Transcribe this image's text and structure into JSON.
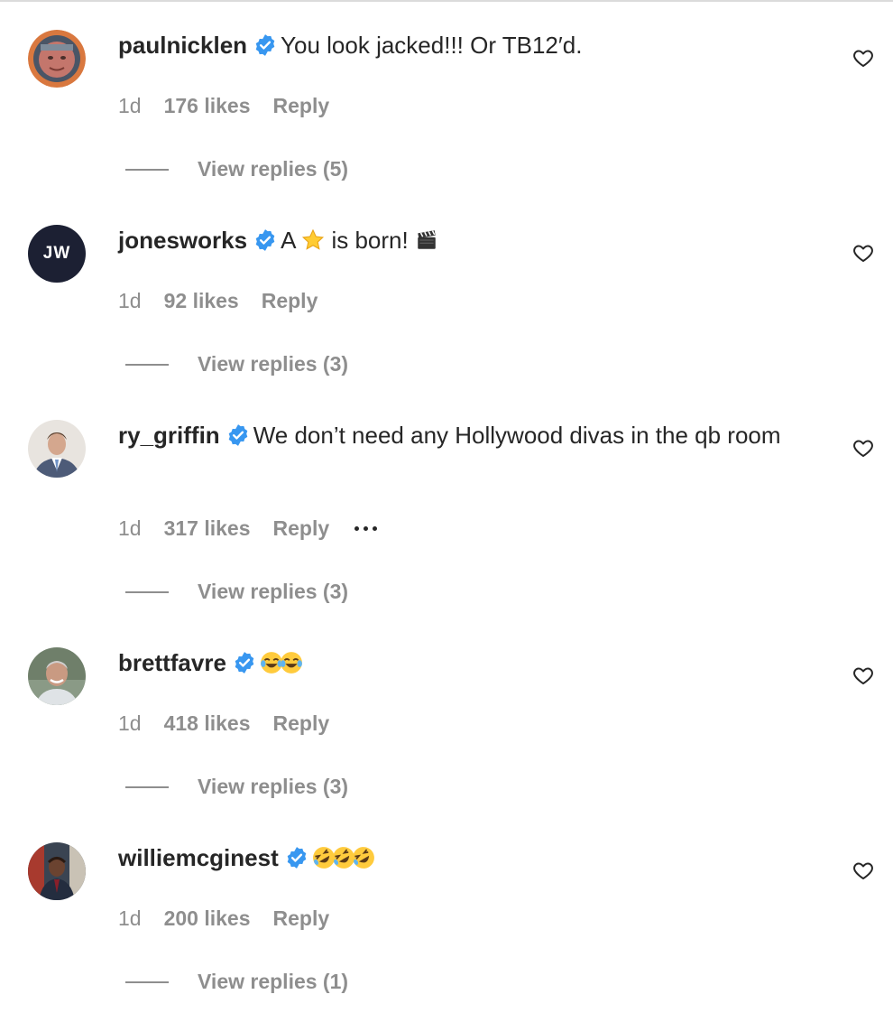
{
  "comments": [
    {
      "username": "paulnicklen",
      "text": "You look jacked!!! Or TB12′d.",
      "emojis": [],
      "time": "1d",
      "likes": "176 likes",
      "reply": "Reply",
      "view_replies": "View replies (5)",
      "avatar": "portrait-orange-badge",
      "verified": true
    },
    {
      "username": "jonesworks",
      "text_before": "A",
      "text_mid": "is born!",
      "emojis": [
        "star-emoji",
        "clapper-board-emoji"
      ],
      "time": "1d",
      "likes": "92 likes",
      "reply": "Reply",
      "view_replies": "View replies (3)",
      "avatar_initials": "JW",
      "verified": true
    },
    {
      "username": "ry_griffin",
      "text": "We don’t need any Hollywood divas in the qb room",
      "time": "1d",
      "likes": "317 likes",
      "reply": "Reply",
      "view_replies": "View replies (3)",
      "avatar": "portrait-suit",
      "verified": true,
      "has_more_menu": true
    },
    {
      "username": "brettfavre",
      "emojis": [
        "tears-of-joy-emoji",
        "tears-of-joy-emoji"
      ],
      "time": "1d",
      "likes": "418 likes",
      "reply": "Reply",
      "view_replies": "View replies (3)",
      "avatar": "portrait-gray-hair",
      "verified": true
    },
    {
      "username": "williemcginest",
      "emojis": [
        "rolling-laughing-emoji",
        "rolling-laughing-emoji",
        "rolling-laughing-emoji"
      ],
      "time": "1d",
      "likes": "200 likes",
      "reply": "Reply",
      "view_replies": "View replies (1)",
      "avatar": "portrait-suit-dark",
      "verified": true
    }
  ],
  "colors": {
    "text": "#262626",
    "secondary": "#8e8e8e",
    "verified_blue": "#3897f0",
    "divider": "#dbdbdb"
  }
}
